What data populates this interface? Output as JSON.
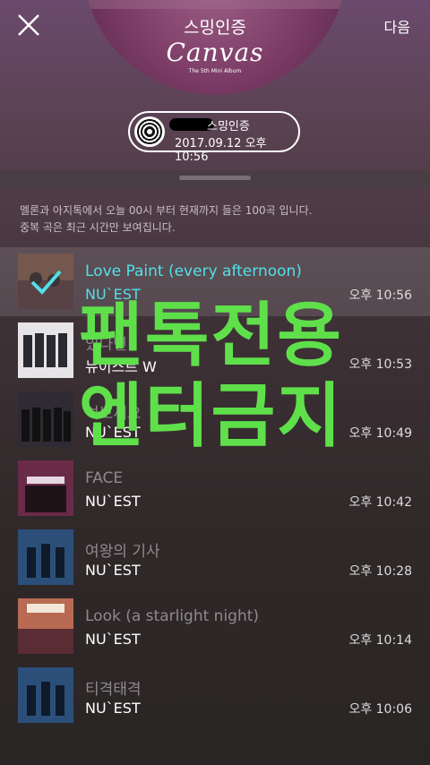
{
  "header": {
    "title": "스밍인증",
    "next_label": "다음"
  },
  "album": {
    "title": "Canvas",
    "subtitle": "The 5th Mini Album"
  },
  "certificate": {
    "label": "스밍인증",
    "timestamp": "2017.09.12 오후 10:56"
  },
  "notice": {
    "line1": "멜론과 아지톡에서 오늘 00시 부터 현재까지 들은 100곡 입니다.",
    "line2": "중복 곡은 최근 시간만 보여집니다."
  },
  "songs": [
    {
      "title": "Love Paint (every afternoon)",
      "artist": "NU`EST",
      "time": "오후 10:56"
    },
    {
      "title": "있다면",
      "artist": "뉴이스트 W",
      "time": "오후 10:53"
    },
    {
      "title": "여보세요",
      "artist": "NU`EST",
      "time": "오후 10:49"
    },
    {
      "title": "FACE",
      "artist": "NU`EST",
      "time": "오후 10:42"
    },
    {
      "title": "여왕의 기사",
      "artist": "NU`EST",
      "time": "오후 10:28"
    },
    {
      "title": "Look (a starlight night)",
      "artist": "NU`EST",
      "time": "오후 10:14"
    },
    {
      "title": "티격태격",
      "artist": "NU`EST",
      "time": "오후 10:06"
    }
  ],
  "watermark": {
    "line1": "팬톡전용",
    "line2": "엔터금지"
  },
  "colors": {
    "active_accent": "#52e0e8",
    "watermark": "#5fe04b"
  }
}
